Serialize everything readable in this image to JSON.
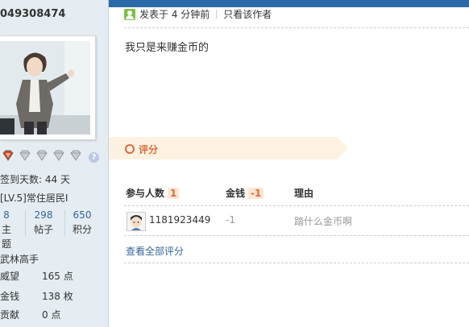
{
  "user": {
    "uid": "049308474",
    "sign_days": "签到天数: 44 天",
    "level": "[LV.5]常住居民I",
    "stats": [
      {
        "value": "8",
        "label": "主题"
      },
      {
        "value": "298",
        "label": "帖子"
      },
      {
        "value": "650",
        "label": "积分"
      }
    ],
    "rank": "武林高手",
    "props": [
      {
        "label": "威望",
        "value": "165 点"
      },
      {
        "label": "金钱",
        "value": "138 枚"
      },
      {
        "label": "贡献",
        "value": "0 点"
      }
    ],
    "help_mark": "?"
  },
  "post": {
    "time": "发表于 4 分钟前",
    "only_author": "只看该作者",
    "content": "我只是来赚金币的"
  },
  "rating": {
    "title": "评分",
    "col_participants": "参与人数",
    "participants_count": "1",
    "col_money": "金钱",
    "money_total": "-1",
    "col_reason": "理由",
    "rows": [
      {
        "user": "1181923449",
        "money": "-1",
        "reason": "踏什么金币啊"
      }
    ],
    "view_all": "查看全部评分"
  },
  "colors": {
    "accent_orange": "#e06a3a",
    "link_blue": "#336699",
    "sidebar_bg": "#e5edf2"
  }
}
